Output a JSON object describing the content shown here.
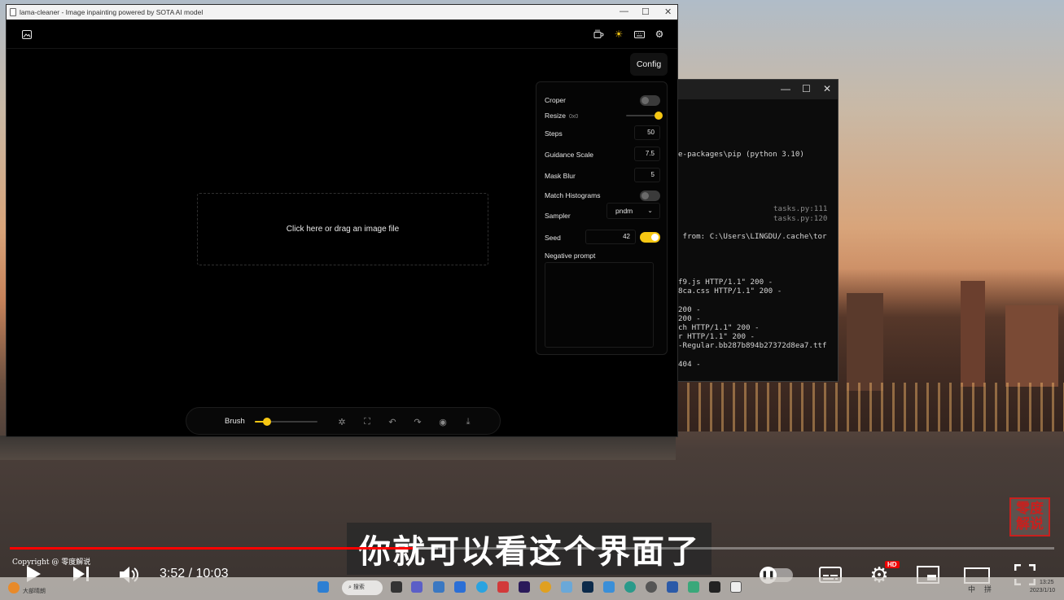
{
  "window": {
    "title": "lama-cleaner - Image inpainting powered by SOTA AI model",
    "controls": {
      "minimize": "—",
      "maximize": "☐",
      "close": "✕"
    }
  },
  "header": {
    "icons": [
      "image-icon",
      "coffee-icon",
      "sun-icon",
      "keyboard-icon",
      "gear-icon"
    ]
  },
  "config_button": "Config",
  "dropzone": "Click here or drag an image file",
  "settings": {
    "croper": {
      "label": "Croper",
      "enabled": false
    },
    "resize": {
      "label": "Resize",
      "sub": "0x0",
      "value": 1.0
    },
    "steps": {
      "label": "Steps",
      "value": "50"
    },
    "guidance_scale": {
      "label": "Guidance Scale",
      "value": "7.5"
    },
    "mask_blur": {
      "label": "Mask Blur",
      "value": "5"
    },
    "match_histograms": {
      "label": "Match Histograms",
      "enabled": false
    },
    "sampler": {
      "label": "Sampler",
      "value": "pndm"
    },
    "seed": {
      "label": "Seed",
      "value": "42",
      "enabled": true
    },
    "negative_prompt": {
      "label": "Negative prompt",
      "value": ""
    }
  },
  "toolbar": {
    "brush_label": "Brush",
    "brush_size": 0.2,
    "icons": [
      "magic-icon",
      "fullscreen-icon",
      "undo-icon",
      "redo-icon",
      "eye-icon",
      "download-icon"
    ]
  },
  "terminal": {
    "lines": [
      "e-packages\\pip (python 3.10)",
      "tasks.py:111",
      "tasks.py:120",
      " from: C:\\Users\\LINGDU/.cache\\tor",
      "f9.js HTTP/1.1\" 200 -",
      "8ca.css HTTP/1.1\" 200 -",
      "200 -",
      "200 -",
      "ch HTTP/1.1\" 200 -",
      "r HTTP/1.1\" 200 -",
      "-Regular.bb287b894b27372d8ea7.ttf",
      "404 -"
    ]
  },
  "player": {
    "subtitle": "你就可以看这个界面了",
    "seal": "零度解说",
    "copyright": "Copyright @ 零度解说",
    "time": "3:52 / 10:03",
    "progress": 0.386,
    "buffered": 0.41,
    "hd": "HD"
  },
  "taskbar": {
    "search": "搜索",
    "weather": "大部晴朗",
    "time": "13:25",
    "date": "2023/1/10",
    "ime": "中",
    "ime2": "拼"
  },
  "colors": {
    "accent": "#f6c713",
    "progress": "#ff0000"
  }
}
